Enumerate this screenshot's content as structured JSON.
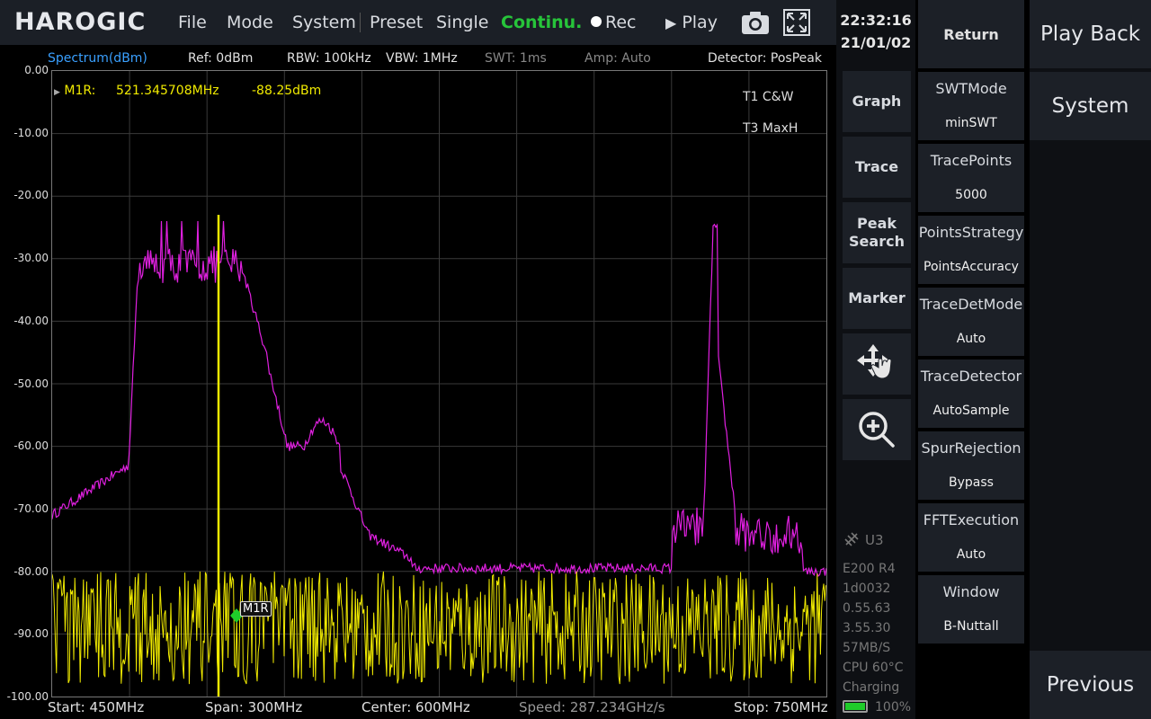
{
  "topbar": {
    "logo": "HAROGIC",
    "menu": [
      "File",
      "Mode",
      "System",
      "Preset",
      "Single",
      "Continu.",
      "Rec",
      "Play"
    ],
    "icons": [
      "camera-icon",
      "fullscreen-icon"
    ]
  },
  "infobar": {
    "mode": "Spectrum(dBm)",
    "ref": "Ref: 0dBm",
    "rbw": "RBW: 100kHz",
    "vbw": "VBW: 1MHz",
    "swt": "SWT: 1ms",
    "amp": "Amp: Auto",
    "detector": "Detector: PosPeak"
  },
  "marker": {
    "label": "M1R:",
    "freq": "521.345708MHz",
    "level": "-88.25dBm",
    "tag": "M1R"
  },
  "legend": {
    "t1": "T1 C&W",
    "t3": "T3 MaxH",
    "t1_color": "#f0ea00",
    "t3_color": "#e020e0"
  },
  "yaxis": [
    "0.00",
    "-10.00",
    "-20.00",
    "-30.00",
    "-40.00",
    "-50.00",
    "-60.00",
    "-70.00",
    "-80.00",
    "-90.00",
    "-100.00"
  ],
  "bottombar": {
    "start": "Start: 450MHz",
    "span": "Span: 300MHz",
    "center": "Center: 600MHz",
    "speed": "Speed: 287.234GHz/s",
    "stop": "Stop: 750MHz"
  },
  "clock": {
    "time": "22:32:16",
    "date": "21/01/02"
  },
  "nav": {
    "graph": "Graph",
    "trace": "Trace",
    "peak1": "Peak",
    "peak2": "Search",
    "marker": "Marker"
  },
  "status": {
    "usb": "U3",
    "model": "E200 R4",
    "build": "1d0032",
    "ver1": "0.55.63",
    "ver2": "3.55.30",
    "rate": "57MB/S",
    "cpu": "CPU  60°C",
    "charging": "Charging",
    "battery": "100%"
  },
  "params": {
    "return": "Return",
    "items": [
      {
        "title": "SWTMode",
        "value": "minSWT"
      },
      {
        "title": "TracePoints",
        "value": "5000"
      },
      {
        "title": "PointsStrategy",
        "value": "PointsAccuracy"
      },
      {
        "title": "TraceDetMode",
        "value": "Auto"
      },
      {
        "title": "TraceDetector",
        "value": "AutoSample"
      },
      {
        "title": "SpurRejection",
        "value": "Bypass"
      },
      {
        "title": "FFTExecution",
        "value": "Auto"
      },
      {
        "title": "Window",
        "value": "B-Nuttall"
      }
    ]
  },
  "far": {
    "playback": "Play Back",
    "system": "System",
    "previous": "Previous"
  }
}
